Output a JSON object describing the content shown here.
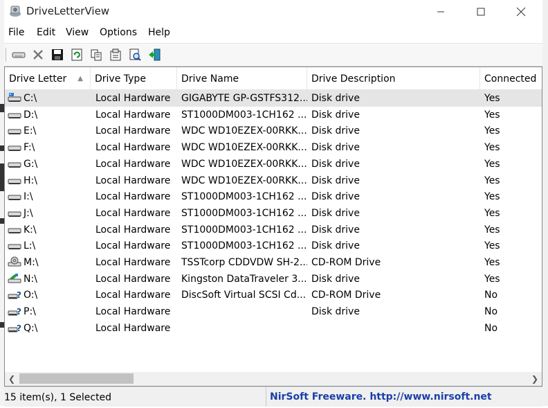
{
  "window": {
    "title": "DriveLetterView"
  },
  "menu": [
    "File",
    "Edit",
    "View",
    "Options",
    "Help"
  ],
  "toolbar": [
    "drive-icon",
    "delete-icon",
    "save-icon",
    "refresh-icon",
    "copy-icon",
    "properties-icon",
    "find-icon",
    "exit-icon"
  ],
  "columns": [
    "Drive Letter",
    "Drive Type",
    "Drive Name",
    "Drive Description",
    "Connected"
  ],
  "rows": [
    {
      "letter": "C:\\",
      "type": "Local Hardware",
      "name": "GIGABYTE GP-GSTFS312...",
      "description": "Disk drive",
      "connected": "Yes",
      "icon": "ssd-drive-icon",
      "selected": true
    },
    {
      "letter": "D:\\",
      "type": "Local Hardware",
      "name": "ST1000DM003-1CH162 ...",
      "description": "Disk drive",
      "connected": "Yes",
      "icon": "hard-drive-icon"
    },
    {
      "letter": "E:\\",
      "type": "Local Hardware",
      "name": "WDC WD10EZEX-00RKK...",
      "description": "Disk drive",
      "connected": "Yes",
      "icon": "hard-drive-icon"
    },
    {
      "letter": "F:\\",
      "type": "Local Hardware",
      "name": "WDC WD10EZEX-00RKK...",
      "description": "Disk drive",
      "connected": "Yes",
      "icon": "hard-drive-icon"
    },
    {
      "letter": "G:\\",
      "type": "Local Hardware",
      "name": "WDC WD10EZEX-00RKK...",
      "description": "Disk drive",
      "connected": "Yes",
      "icon": "hard-drive-icon"
    },
    {
      "letter": "H:\\",
      "type": "Local Hardware",
      "name": "WDC WD10EZEX-00RKK...",
      "description": "Disk drive",
      "connected": "Yes",
      "icon": "hard-drive-icon"
    },
    {
      "letter": "I:\\",
      "type": "Local Hardware",
      "name": "ST1000DM003-1CH162 ...",
      "description": "Disk drive",
      "connected": "Yes",
      "icon": "hard-drive-icon"
    },
    {
      "letter": "J:\\",
      "type": "Local Hardware",
      "name": "ST1000DM003-1CH162 ...",
      "description": "Disk drive",
      "connected": "Yes",
      "icon": "hard-drive-icon"
    },
    {
      "letter": "K:\\",
      "type": "Local Hardware",
      "name": "ST1000DM003-1CH162 ...",
      "description": "Disk drive",
      "connected": "Yes",
      "icon": "hard-drive-icon"
    },
    {
      "letter": "L:\\",
      "type": "Local Hardware",
      "name": "ST1000DM003-1CH162 ...",
      "description": "Disk drive",
      "connected": "Yes",
      "icon": "hard-drive-icon"
    },
    {
      "letter": "M:\\",
      "type": "Local Hardware",
      "name": "TSSTcorp CDDVDW SH-2...",
      "description": "CD-ROM Drive",
      "connected": "Yes",
      "icon": "cd-drive-icon"
    },
    {
      "letter": "N:\\",
      "type": "Local Hardware",
      "name": "Kingston DataTraveler 3....",
      "description": "Disk drive",
      "connected": "Yes",
      "icon": "usb-drive-icon"
    },
    {
      "letter": "O:\\",
      "type": "Local Hardware",
      "name": "DiscSoft Virtual SCSI Cd...",
      "description": "CD-ROM Drive",
      "connected": "No",
      "icon": "unknown-drive-icon"
    },
    {
      "letter": "P:\\",
      "type": "Local Hardware",
      "name": "",
      "description": "Disk drive",
      "connected": "No",
      "icon": "unknown-drive-icon"
    },
    {
      "letter": "Q:\\",
      "type": "Local Hardware",
      "name": "",
      "description": "",
      "connected": "No",
      "icon": "unknown-drive-icon"
    }
  ],
  "status": {
    "count": "15 item(s), 1 Selected",
    "link": "NirSoft Freeware.  http://www.nirsoft.net"
  },
  "colors": {
    "selected_row": "#e5e5e5",
    "link": "#1a3fa8"
  }
}
